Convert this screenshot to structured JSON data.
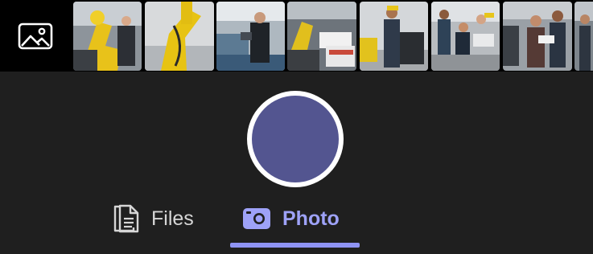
{
  "gallery": {
    "icon": "image-gallery-icon",
    "thumbnails": [
      "robotic-arm-workers",
      "yellow-robot-arm",
      "engineer-with-tablet",
      "factory-robot-boxes",
      "worker-at-console",
      "team-at-laptop",
      "engineers-reviewing-plans"
    ]
  },
  "shutter": {
    "color": "#535590",
    "ring": "#ffffff"
  },
  "modes": {
    "files": {
      "label": "Files",
      "icon": "document-icon"
    },
    "photo": {
      "label": "Photo",
      "icon": "camera-icon",
      "selected": true
    }
  },
  "colors": {
    "accent": "#9ea2f8",
    "background": "#1f1f1f"
  }
}
